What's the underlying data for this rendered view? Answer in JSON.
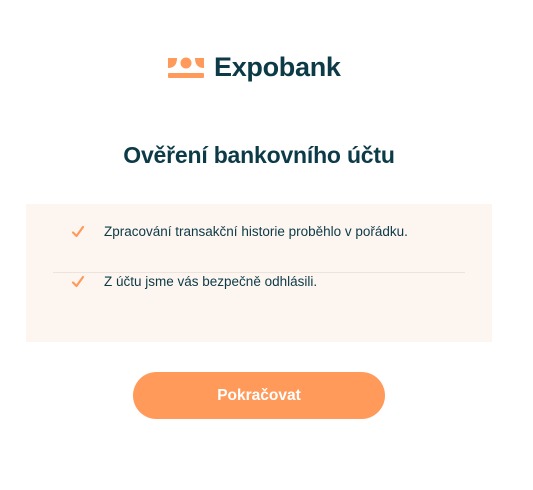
{
  "brand": {
    "name": "Expobank",
    "logo_icon": "expobank-logo-icon",
    "colors": {
      "accent": "#ff9a5a",
      "text": "#0c3a47",
      "panel": "#fdf5f0"
    }
  },
  "page": {
    "title": "Ověření bankovního účtu"
  },
  "status": {
    "items": [
      {
        "icon": "check-icon",
        "text": "Zpracování transakční historie proběhlo v pořádku."
      },
      {
        "icon": "check-icon",
        "text": "Z účtu jsme vás bezpečně odhlásili."
      }
    ]
  },
  "actions": {
    "continue_label": "Pokračovat"
  }
}
